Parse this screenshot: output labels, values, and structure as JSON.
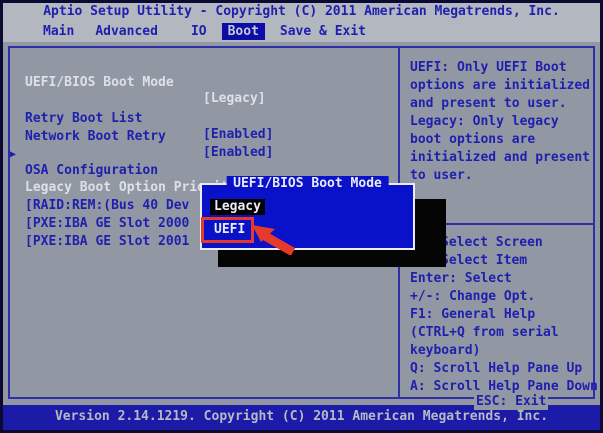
{
  "title_bar": {
    "text": "Aptio Setup Utility - Copyright (C) 2011 American Megatrends, Inc."
  },
  "menu": {
    "items": [
      "Main",
      "Advanced",
      "IO",
      "Boot",
      "Save & Exit"
    ],
    "active": "Boot"
  },
  "left_pane": {
    "items": [
      {
        "label": "UEFI/BIOS Boot Mode",
        "value": "[Legacy]",
        "selected": true
      },
      {
        "label": "Retry Boot List",
        "value": "[Enabled]",
        "selected": false
      },
      {
        "label": "Network Boot Retry",
        "value": "[Enabled]",
        "selected": false
      },
      {
        "label": "OSA Configuration",
        "value": "",
        "selected": false,
        "submenu": true
      }
    ],
    "submenu_arrow": "▶",
    "section_header": "Legacy Boot Option Priority",
    "boot_options": [
      "[RAID:REM:(Bus 40 Dev",
      "[PXE:IBA GE Slot 2000",
      "[PXE:IBA GE Slot 2001"
    ]
  },
  "popup": {
    "title": "UEFI/BIOS Boot Mode",
    "options": [
      {
        "label": "Legacy",
        "highlighted": true
      },
      {
        "label": "UEFI",
        "annotated": true
      }
    ],
    "annotation_color": "#e53a2b"
  },
  "help_pane": {
    "lines": [
      "UEFI: Only UEFI Boot",
      "options are initialized",
      "and present to user.",
      "Legacy: Only legacy",
      "boot options are",
      "initialized and present",
      "to user."
    ]
  },
  "key_legend": {
    "lines": [
      "Select Screen",
      "Select Item",
      "Enter: Select",
      "+/-: Change Opt.",
      "F1: General Help",
      "(CTRL+Q from serial",
      "keyboard)",
      "Q: Scroll Help Pane Up",
      "A: Scroll Help Pane Down"
    ],
    "esc": "ESC: Exit"
  },
  "bottom_bar": {
    "text": "Version 2.14.1219. Copyright (C) 2011 American Megatrends, Inc."
  },
  "colors": {
    "body_gray": "#9298a3",
    "bar_gray": "#b3b7bf",
    "text_blue": "#1f1fad",
    "text_white": "#dde0e7",
    "popup_blue": "#0a12c9",
    "frame_blue": "#2e2ea6",
    "bottom_bar_blue": "#1b1ba8",
    "annotation_red": "#e53a2b",
    "shadow_black": "#050505"
  }
}
